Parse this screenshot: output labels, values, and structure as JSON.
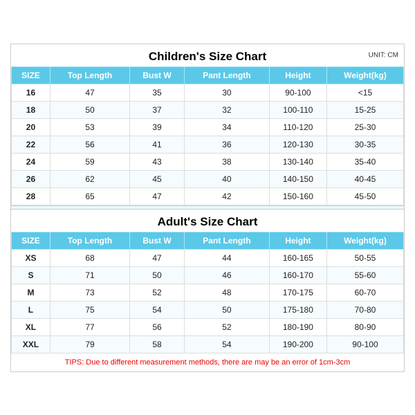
{
  "children_title": "Children's Size Chart",
  "adult_title": "Adult's Size Chart",
  "unit_label": "UNIT: CM",
  "tips": "TIPS: Due to different measurement methods, there are may be an error of 1cm-3cm",
  "children_headers": [
    "SIZE",
    "Top Length",
    "Bust W",
    "Pant Length",
    "Height",
    "Weight(kg)"
  ],
  "children_rows": [
    [
      "16",
      "47",
      "35",
      "30",
      "90-100",
      "<15"
    ],
    [
      "18",
      "50",
      "37",
      "32",
      "100-110",
      "15-25"
    ],
    [
      "20",
      "53",
      "39",
      "34",
      "110-120",
      "25-30"
    ],
    [
      "22",
      "56",
      "41",
      "36",
      "120-130",
      "30-35"
    ],
    [
      "24",
      "59",
      "43",
      "38",
      "130-140",
      "35-40"
    ],
    [
      "26",
      "62",
      "45",
      "40",
      "140-150",
      "40-45"
    ],
    [
      "28",
      "65",
      "47",
      "42",
      "150-160",
      "45-50"
    ]
  ],
  "adult_headers": [
    "SIZE",
    "Top Length",
    "Bust W",
    "Pant Length",
    "Height",
    "Weight(kg)"
  ],
  "adult_rows": [
    [
      "XS",
      "68",
      "47",
      "44",
      "160-165",
      "50-55"
    ],
    [
      "S",
      "71",
      "50",
      "46",
      "160-170",
      "55-60"
    ],
    [
      "M",
      "73",
      "52",
      "48",
      "170-175",
      "60-70"
    ],
    [
      "L",
      "75",
      "54",
      "50",
      "175-180",
      "70-80"
    ],
    [
      "XL",
      "77",
      "56",
      "52",
      "180-190",
      "80-90"
    ],
    [
      "XXL",
      "79",
      "58",
      "54",
      "190-200",
      "90-100"
    ]
  ]
}
